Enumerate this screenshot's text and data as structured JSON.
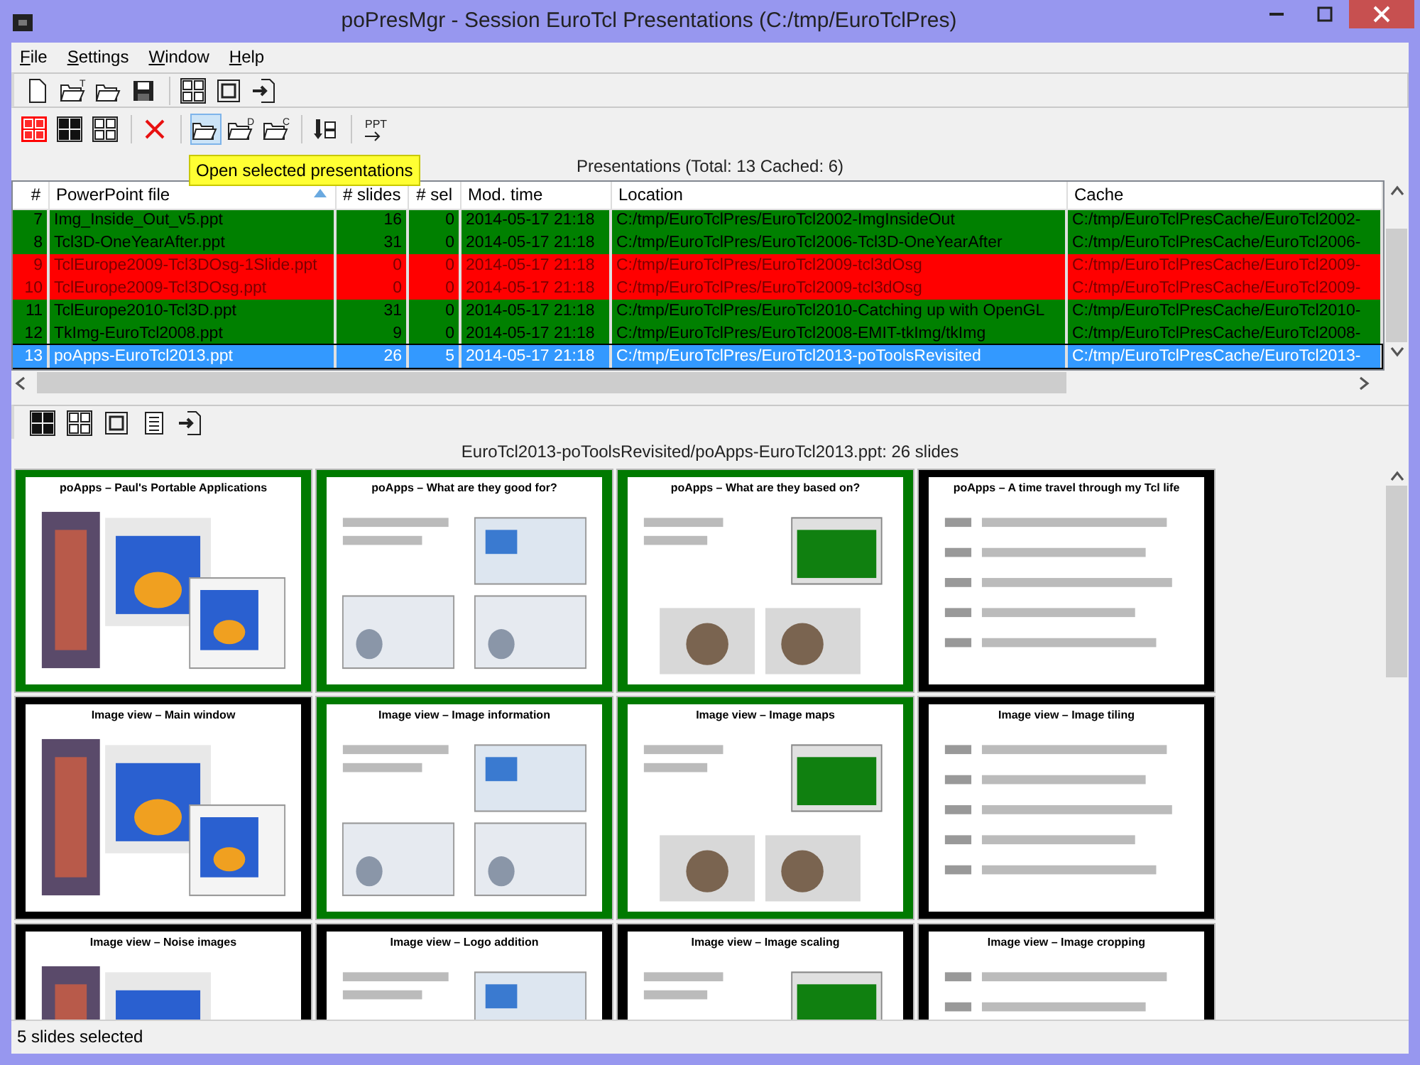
{
  "window": {
    "title": "poPresMgr - Session EuroTcl Presentations (C:/tmp/EuroTclPres)"
  },
  "menu": [
    {
      "label": "File"
    },
    {
      "label": "Settings"
    },
    {
      "label": "Window"
    },
    {
      "label": "Help"
    }
  ],
  "toolbar_1": [
    {
      "kind": "new",
      "pressed": false
    },
    {
      "kind": "open",
      "label": "T",
      "pressed": false
    },
    {
      "kind": "open",
      "pressed": false
    },
    {
      "kind": "save",
      "pressed": false
    },
    {
      "kind": "sep"
    },
    {
      "kind": "grid-outline",
      "pressed": false
    },
    {
      "kind": "single",
      "pressed": false
    },
    {
      "kind": "import",
      "pressed": false
    }
  ],
  "toolbar_2": [
    {
      "kind": "grid-red",
      "pressed": false
    },
    {
      "kind": "grid-black",
      "pressed": false
    },
    {
      "kind": "grid-outline",
      "pressed": false
    },
    {
      "kind": "sep"
    },
    {
      "kind": "delete",
      "pressed": false
    },
    {
      "kind": "sep"
    },
    {
      "kind": "open",
      "pressed": true
    },
    {
      "kind": "open",
      "label": "D",
      "pressed": false
    },
    {
      "kind": "open",
      "label": "C",
      "pressed": false
    },
    {
      "kind": "sep"
    },
    {
      "kind": "move",
      "pressed": false
    },
    {
      "kind": "sep"
    },
    {
      "kind": "convert",
      "label": "PPT",
      "pressed": false
    }
  ],
  "tooltip": {
    "text": "Open selected presentations"
  },
  "presentations": {
    "caption": "Presentations (Total: 13 Cached: 6)",
    "columns": [
      {
        "label": "#",
        "sorted": false
      },
      {
        "label": "PowerPoint file",
        "sorted": true
      },
      {
        "label": "# slides",
        "sorted": false
      },
      {
        "label": "# sel",
        "sorted": false
      },
      {
        "label": "Mod. time",
        "sorted": false
      },
      {
        "label": "Location",
        "sorted": false
      },
      {
        "label": "Cache",
        "sorted": false
      }
    ],
    "rows": [
      {
        "kind": "cached",
        "selected": false,
        "cells": [
          "7",
          "Img_Inside_Out_v5.ppt",
          "16",
          "0",
          "2014-05-17 21:18",
          "C:/tmp/EuroTclPres/EuroTcl2002-ImgInsideOut",
          "C:/tmp/EuroTclPresCache/EuroTcl2002-"
        ]
      },
      {
        "kind": "cached",
        "selected": false,
        "cells": [
          "8",
          "Tcl3D-OneYearAfter.ppt",
          "31",
          "0",
          "2014-05-17 21:18",
          "C:/tmp/EuroTclPres/EuroTcl2006-Tcl3D-OneYearAfter",
          "C:/tmp/EuroTclPresCache/EuroTcl2006-"
        ]
      },
      {
        "kind": "missing",
        "selected": false,
        "cells": [
          "9",
          "TclEurope2009-Tcl3DOsg-1Slide.ppt",
          "0",
          "0",
          "2014-05-17 21:18",
          "C:/tmp/EuroTclPres/EuroTcl2009-tcl3dOsg",
          "C:/tmp/EuroTclPresCache/EuroTcl2009-"
        ]
      },
      {
        "kind": "missing",
        "selected": false,
        "cells": [
          "10",
          "TclEurope2009-Tcl3DOsg.ppt",
          "0",
          "0",
          "2014-05-17 21:18",
          "C:/tmp/EuroTclPres/EuroTcl2009-tcl3dOsg",
          "C:/tmp/EuroTclPresCache/EuroTcl2009-"
        ]
      },
      {
        "kind": "cached",
        "selected": false,
        "cells": [
          "11",
          "TclEurope2010-Tcl3D.ppt",
          "31",
          "0",
          "2014-05-17 21:18",
          "C:/tmp/EuroTclPres/EuroTcl2010-Catching up with OpenGL",
          "C:/tmp/EuroTclPresCache/EuroTcl2010-"
        ]
      },
      {
        "kind": "cached",
        "selected": false,
        "cells": [
          "12",
          "TkImg-EuroTcl2008.ppt",
          "9",
          "0",
          "2014-05-17 21:18",
          "C:/tmp/EuroTclPres/EuroTcl2008-EMIT-tkImg/tkImg",
          "C:/tmp/EuroTclPresCache/EuroTcl2008-"
        ]
      },
      {
        "kind": "cached",
        "selected": true,
        "cells": [
          "13",
          "poApps-EuroTcl2013.ppt",
          "26",
          "5",
          "2014-05-17 21:18",
          "C:/tmp/EuroTclPres/EuroTcl2013-poToolsRevisited",
          "C:/tmp/EuroTclPresCache/EuroTcl2013-"
        ]
      }
    ]
  },
  "slides_toolbar": [
    {
      "kind": "grid-black",
      "pressed": false
    },
    {
      "kind": "grid-outline",
      "pressed": false
    },
    {
      "kind": "single",
      "pressed": false
    },
    {
      "kind": "list",
      "pressed": false
    },
    {
      "kind": "import",
      "pressed": false
    }
  ],
  "slides": {
    "caption": "EuroTcl2013-poToolsRevisited/poApps-EuroTcl2013.ppt: 26 slides",
    "items": [
      {
        "title": "poApps – Paul's Portable Applications",
        "selected": true
      },
      {
        "title": "poApps – What are they good for?",
        "selected": true
      },
      {
        "title": "poApps – What are they based on?",
        "selected": true
      },
      {
        "title": "poApps – A time travel through my Tcl life",
        "selected": false
      },
      {
        "title": "Image view – Main window",
        "selected": false
      },
      {
        "title": "Image view – Image information",
        "selected": true
      },
      {
        "title": "Image view – Image maps",
        "selected": true
      },
      {
        "title": "Image view – Image tiling",
        "selected": false
      },
      {
        "title": "Image view – Noise images",
        "selected": false
      },
      {
        "title": "Image view – Logo addition",
        "selected": false
      },
      {
        "title": "Image view – Image scaling",
        "selected": false
      },
      {
        "title": "Image view – Image cropping",
        "selected": false
      }
    ]
  },
  "status_bar": {
    "text": "5 slides selected"
  }
}
